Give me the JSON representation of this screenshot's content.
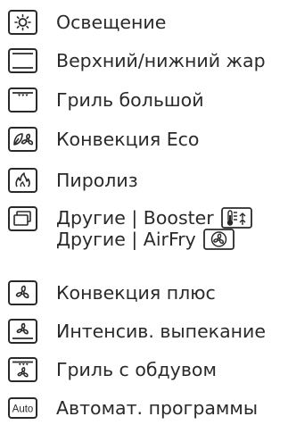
{
  "modes": [
    {
      "icon": "light-bulb-icon",
      "label": "Освещение"
    },
    {
      "icon": "top-bottom-heat-icon",
      "label": "Верхний/нижний жар"
    },
    {
      "icon": "large-grill-icon",
      "label": "Гриль большой"
    },
    {
      "icon": "convection-eco-icon",
      "label": "Конвекция Eco"
    },
    {
      "icon": "pyrolysis-icon",
      "label": "Пиролиз"
    },
    {
      "icon": "other-icon",
      "label_1": "Другие | Booster",
      "booster_icon": "booster-icon",
      "label_2": "Другие | AirFry",
      "airfry_icon": "airfry-icon"
    },
    {
      "icon": "convection-plus-icon",
      "label": "Конвекция плюс"
    },
    {
      "icon": "intensive-baking-icon",
      "label": "Интенсив. выпекание"
    },
    {
      "icon": "fan-grill-icon",
      "label": "Гриль с обдувом"
    },
    {
      "icon": "auto-programs-icon",
      "badge": "Auto",
      "label": "Автомат. программы"
    }
  ]
}
